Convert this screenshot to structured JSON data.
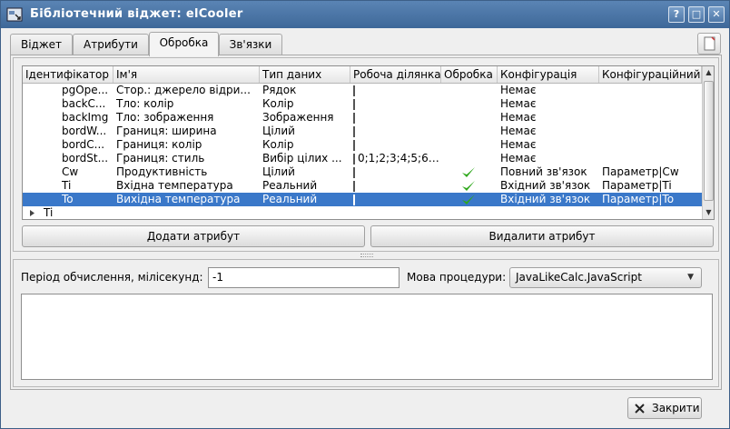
{
  "window": {
    "title": "Бібліотечний віджет: elCooler"
  },
  "titlebar_buttons": {
    "help": "?",
    "maximize": "□",
    "close": "✕"
  },
  "tabs": [
    {
      "label": "Віджет"
    },
    {
      "label": "Атрибути"
    },
    {
      "label": "Обробка"
    },
    {
      "label": "Зв'язки"
    }
  ],
  "table": {
    "headers": [
      "Ідентифікатор",
      "Ім'я",
      "Тип даних",
      "Робоча ділянка",
      "Обробка",
      "Конфігурація",
      "Конфігураційний"
    ],
    "rows": [
      {
        "id": "pgOpe...",
        "name": "Стор.: джерело відри...",
        "type": "Рядок",
        "work": "",
        "proc": false,
        "cfg": "Немає",
        "cfgtpl": ""
      },
      {
        "id": "backC...",
        "name": "Тло: колір",
        "type": "Колір",
        "work": "",
        "proc": false,
        "cfg": "Немає",
        "cfgtpl": ""
      },
      {
        "id": "backImg",
        "name": "Тло: зображення",
        "type": "Зображення",
        "work": "",
        "proc": false,
        "cfg": "Немає",
        "cfgtpl": ""
      },
      {
        "id": "bordW...",
        "name": "Границя: ширина",
        "type": "Цілий",
        "work": "",
        "proc": false,
        "cfg": "Немає",
        "cfgtpl": ""
      },
      {
        "id": "bordC...",
        "name": "Границя: колір",
        "type": "Колір",
        "work": "",
        "proc": false,
        "cfg": "Немає",
        "cfgtpl": ""
      },
      {
        "id": "bordSt...",
        "name": "Границя: стиль",
        "type": "Вибір цілих ...",
        "work": "0;1;2;3;4;5;6;...",
        "proc": false,
        "cfg": "Немає",
        "cfgtpl": ""
      },
      {
        "id": "Cw",
        "name": "Продуктивність",
        "type": "Цілий",
        "work": "",
        "proc": true,
        "cfg": "Повний зв'язок",
        "cfgtpl": "Параметр|Cw"
      },
      {
        "id": "Ti",
        "name": "Вхідна температура",
        "type": "Реальний",
        "work": "",
        "proc": true,
        "cfg": "Вхідний зв'язок",
        "cfgtpl": "Параметр|Ti"
      },
      {
        "id": "To",
        "name": "Вихідна температура",
        "type": "Реальний",
        "work": "",
        "proc": true,
        "cfg": "Вхідний зв'язок",
        "cfgtpl": "Параметр|To",
        "selected": true
      }
    ],
    "tree_row": {
      "label": "Ti"
    }
  },
  "buttons": {
    "add_attr": "Додати атрибут",
    "del_attr": "Видалити атрибут",
    "close": "Закрити"
  },
  "calc": {
    "period_label": "Період обчислення, мілісекунд:",
    "period_value": "-1",
    "lang_label": "Мова процедури:",
    "lang_value": "JavaLikeCalc.JavaScript",
    "code_text": ""
  },
  "icons": [
    "window-app-icon",
    "checkmark-icon",
    "close-x-icon",
    "expand-arrow-icon",
    "page-icon"
  ],
  "colors": {
    "titlebar": "#4a74a6",
    "selection": "#3a78c9",
    "check": "#2fa81c"
  }
}
